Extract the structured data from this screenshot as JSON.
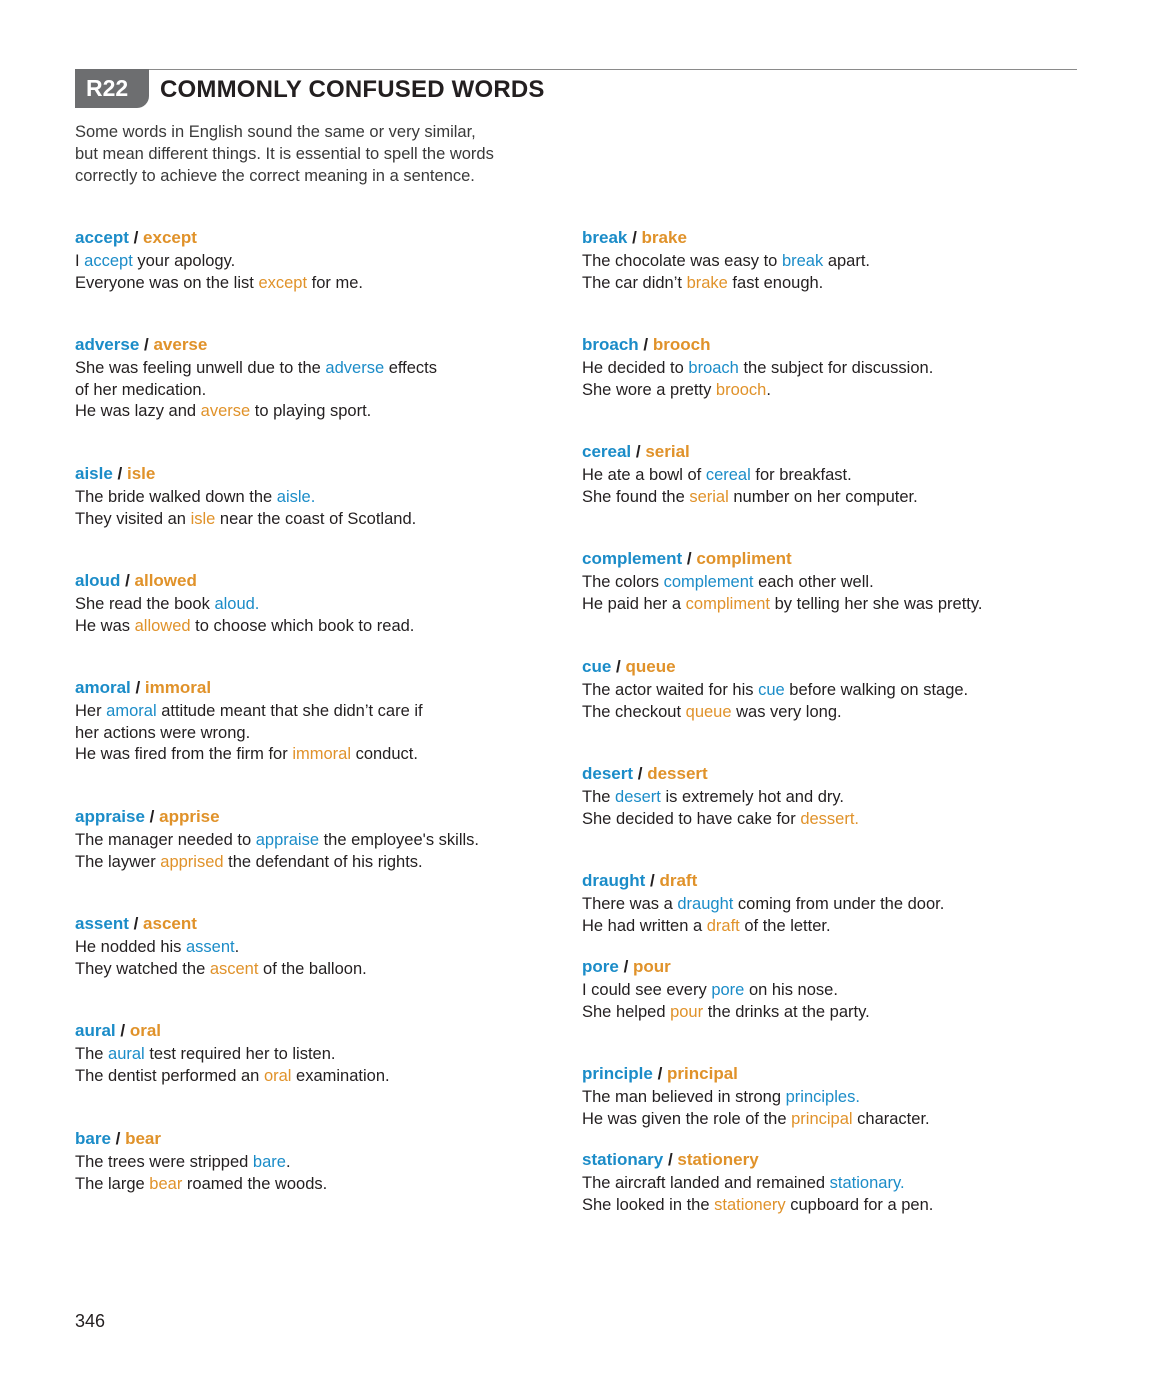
{
  "section": {
    "code": "R22",
    "title": "COMMONLY CONFUSED WORDS"
  },
  "intro": [
    "Some words in English sound the same or very similar,",
    "but mean different things. It is essential to spell the words",
    "correctly to achieve the correct meaning in a sentence."
  ],
  "colors": {
    "word_a": "#1b8cc8",
    "word_b": "#e0922a",
    "tab": "#6d6e70"
  },
  "entries": [
    {
      "a": "accept",
      "b": "except",
      "lines": [
        [
          {
            "t": "I "
          },
          {
            "t": "accept",
            "c": "blue"
          },
          {
            "t": " your apology."
          }
        ],
        [
          {
            "t": "Everyone was on the list "
          },
          {
            "t": "except",
            "c": "orange"
          },
          {
            "t": " for me."
          }
        ]
      ]
    },
    {
      "a": "adverse",
      "b": "averse",
      "lines": [
        [
          {
            "t": "She was feeling unwell due to the "
          },
          {
            "t": "adverse",
            "c": "blue"
          },
          {
            "t": " effects"
          }
        ],
        [
          {
            "t": "of her medication."
          }
        ],
        [
          {
            "t": "He was lazy and "
          },
          {
            "t": "averse",
            "c": "orange"
          },
          {
            "t": " to playing sport."
          }
        ]
      ]
    },
    {
      "a": "aisle",
      "b": "isle",
      "lines": [
        [
          {
            "t": "The bride walked down the "
          },
          {
            "t": "aisle.",
            "c": "blue"
          }
        ],
        [
          {
            "t": "They visited an "
          },
          {
            "t": "isle",
            "c": "orange"
          },
          {
            "t": " near the coast of Scotland."
          }
        ]
      ]
    },
    {
      "a": "aloud",
      "b": "allowed",
      "lines": [
        [
          {
            "t": "She read the book "
          },
          {
            "t": "aloud.",
            "c": "blue"
          }
        ],
        [
          {
            "t": "He was "
          },
          {
            "t": "allowed",
            "c": "orange"
          },
          {
            "t": " to choose which book to read."
          }
        ]
      ]
    },
    {
      "a": "amoral",
      "b": "immoral",
      "lines": [
        [
          {
            "t": "Her "
          },
          {
            "t": "amoral",
            "c": "blue"
          },
          {
            "t": " attitude meant that she didn’t care if"
          }
        ],
        [
          {
            "t": "her actions were wrong."
          }
        ],
        [
          {
            "t": "He was fired from the firm for "
          },
          {
            "t": "immoral",
            "c": "orange"
          },
          {
            "t": " conduct."
          }
        ]
      ]
    },
    {
      "a": "appraise",
      "b": "apprise",
      "lines": [
        [
          {
            "t": "The manager needed to "
          },
          {
            "t": "appraise",
            "c": "blue"
          },
          {
            "t": " the employee's skills."
          }
        ],
        [
          {
            "t": "The laywer "
          },
          {
            "t": "apprised",
            "c": "orange"
          },
          {
            "t": " the defendant of his rights."
          }
        ]
      ]
    },
    {
      "a": "assent",
      "b": "ascent",
      "lines": [
        [
          {
            "t": "He nodded his "
          },
          {
            "t": "assent",
            "c": "blue"
          },
          {
            "t": "."
          }
        ],
        [
          {
            "t": "They watched the "
          },
          {
            "t": "ascent",
            "c": "orange"
          },
          {
            "t": " of the balloon."
          }
        ]
      ]
    },
    {
      "a": "aural",
      "b": "oral",
      "lines": [
        [
          {
            "t": "The "
          },
          {
            "t": "aural",
            "c": "blue"
          },
          {
            "t": " test required her to listen."
          }
        ],
        [
          {
            "t": "The dentist performed an "
          },
          {
            "t": "oral",
            "c": "orange"
          },
          {
            "t": " examination."
          }
        ]
      ]
    },
    {
      "a": "bare",
      "b": "bear",
      "lines": [
        [
          {
            "t": "The trees were stripped "
          },
          {
            "t": "bare",
            "c": "blue"
          },
          {
            "t": "."
          }
        ],
        [
          {
            "t": "The large "
          },
          {
            "t": "bear",
            "c": "orange"
          },
          {
            "t": " roamed the woods."
          }
        ]
      ]
    },
    {
      "a": "break",
      "b": "brake",
      "lines": [
        [
          {
            "t": "The chocolate was easy to "
          },
          {
            "t": "break",
            "c": "blue"
          },
          {
            "t": " apart."
          }
        ],
        [
          {
            "t": "The car didn’t "
          },
          {
            "t": "brake",
            "c": "orange"
          },
          {
            "t": " fast enough."
          }
        ]
      ]
    },
    {
      "a": "broach",
      "b": "brooch",
      "lines": [
        [
          {
            "t": "He decided to "
          },
          {
            "t": "broach",
            "c": "blue"
          },
          {
            "t": " the subject for discussion."
          }
        ],
        [
          {
            "t": "She wore a pretty "
          },
          {
            "t": "brooch",
            "c": "orange"
          },
          {
            "t": "."
          }
        ]
      ]
    },
    {
      "a": "cereal",
      "b": "serial",
      "lines": [
        [
          {
            "t": "He ate a bowl of "
          },
          {
            "t": "cereal",
            "c": "blue"
          },
          {
            "t": " for breakfast."
          }
        ],
        [
          {
            "t": "She found the "
          },
          {
            "t": "serial",
            "c": "orange"
          },
          {
            "t": " number on her computer."
          }
        ]
      ]
    },
    {
      "a": "complement",
      "b": "compliment",
      "lines": [
        [
          {
            "t": "The colors "
          },
          {
            "t": "complement",
            "c": "blue"
          },
          {
            "t": " each other well."
          }
        ],
        [
          {
            "t": "He paid her a "
          },
          {
            "t": "compliment",
            "c": "orange"
          },
          {
            "t": " by telling her she was pretty."
          }
        ]
      ]
    },
    {
      "a": "cue",
      "b": "queue",
      "lines": [
        [
          {
            "t": "The actor waited for his "
          },
          {
            "t": "cue",
            "c": "blue"
          },
          {
            "t": " before walking on stage."
          }
        ],
        [
          {
            "t": "The checkout "
          },
          {
            "t": "queue",
            "c": "orange"
          },
          {
            "t": " was very long."
          }
        ]
      ]
    },
    {
      "a": "desert",
      "b": "dessert",
      "lines": [
        [
          {
            "t": "The "
          },
          {
            "t": "desert",
            "c": "blue"
          },
          {
            "t": " is extremely hot and dry."
          }
        ],
        [
          {
            "t": "She decided to have cake for "
          },
          {
            "t": "dessert.",
            "c": "orange"
          }
        ]
      ]
    },
    {
      "a": "draught",
      "b": "draft",
      "lines": [
        [
          {
            "t": "There was a "
          },
          {
            "t": "draught",
            "c": "blue"
          },
          {
            "t": " coming from under the door."
          }
        ],
        [
          {
            "t": "He had written a "
          },
          {
            "t": "draft",
            "c": "orange"
          },
          {
            "t": " of the letter."
          }
        ]
      ]
    },
    {
      "a": "pore",
      "b": "pour",
      "lines": [
        [
          {
            "t": "I could see every "
          },
          {
            "t": "pore",
            "c": "blue"
          },
          {
            "t": " on his nose."
          }
        ],
        [
          {
            "t": "She helped "
          },
          {
            "t": "pour",
            "c": "orange"
          },
          {
            "t": " the drinks at the party."
          }
        ]
      ]
    },
    {
      "a": "principle",
      "b": "principal",
      "lines": [
        [
          {
            "t": "The man believed in strong "
          },
          {
            "t": "principles.",
            "c": "blue"
          }
        ],
        [
          {
            "t": "He was given the role of the "
          },
          {
            "t": "principal",
            "c": "orange"
          },
          {
            "t": " character."
          }
        ]
      ]
    },
    {
      "a": "stationary",
      "b": "stationery",
      "lines": [
        [
          {
            "t": "The aircraft landed and remained "
          },
          {
            "t": "stationary.",
            "c": "blue"
          }
        ],
        [
          {
            "t": "She looked in the "
          },
          {
            "t": "stationery",
            "c": "orange"
          },
          {
            "t": " cupboard for a pen."
          }
        ]
      ]
    }
  ],
  "page_number": "346"
}
